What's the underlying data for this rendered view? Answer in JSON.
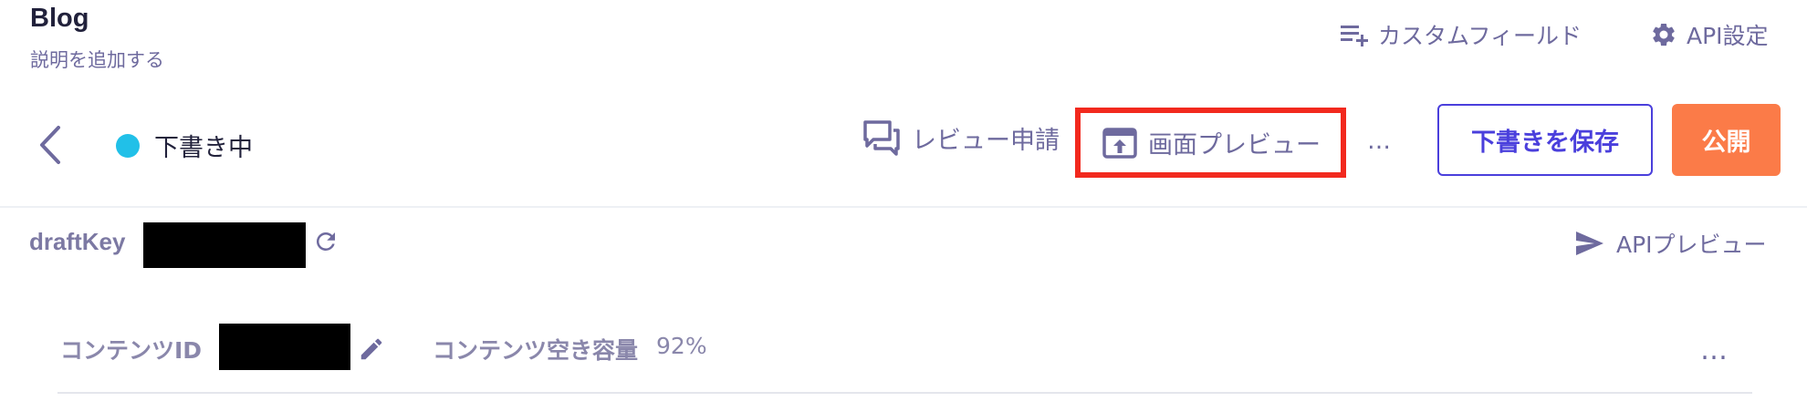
{
  "header": {
    "title": "Blog",
    "subtitle": "説明を追加する",
    "actions": {
      "custom_fields": "カスタムフィールド",
      "api_settings": "API設定"
    }
  },
  "toolbar": {
    "status_label": "下書き中",
    "status_color": "#21c0e8",
    "review_request": "レビュー申請",
    "screen_preview": "画面プレビュー",
    "more": "…",
    "save_draft": "下書きを保存",
    "publish": "公開",
    "accent": "#4a3fdc",
    "publish_color": "#fb7b48",
    "highlight_color": "#f2291e"
  },
  "draft": {
    "label": "draftKey",
    "api_preview": "APIプレビュー"
  },
  "content": {
    "id_label": "コンテンツID",
    "free_space_label": "コンテンツ空き容量",
    "free_space_value": "92%",
    "more": "…"
  },
  "icons": {
    "custom_fields": "playlist-add-icon",
    "api_settings": "gear-icon",
    "back": "chevron-left-icon",
    "review_request": "chat-bubbles-icon",
    "screen_preview": "upload-window-icon",
    "refresh": "refresh-icon",
    "api_preview": "send-icon",
    "edit": "pencil-icon"
  }
}
